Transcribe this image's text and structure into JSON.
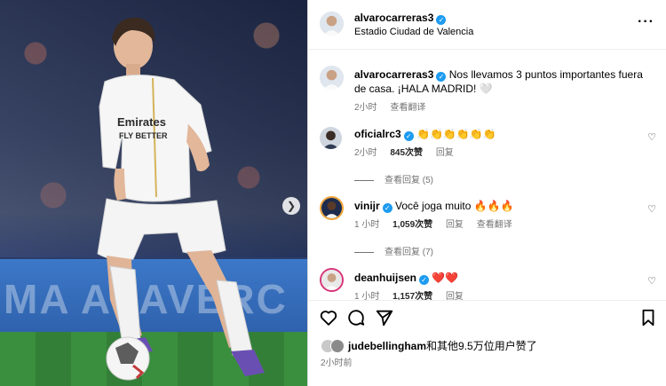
{
  "media": {
    "next_icon": "chevron-right-icon",
    "board_text": "MA ALAVERC"
  },
  "post_header": {
    "username": "alvarocarreras3",
    "location": "Estadio Ciudad de Valencia",
    "more_icon": "more-horizontal-icon",
    "more_label": "···"
  },
  "caption": {
    "username": "alvarocarreras3",
    "text": "Nos llevamos 3 puntos importantes fuera de casa. ¡HALA MADRID! 🤍",
    "time": "2小时",
    "translate": "查看翻译"
  },
  "comments": [
    {
      "username": "oficialrc3",
      "text": "👏👏👏👏👏👏",
      "time": "2小时",
      "likes": "845次赞",
      "reply": "回复",
      "translate": "",
      "view_replies": "查看回复 (5)"
    },
    {
      "username": "vinijr",
      "text": "Você joga muito 🔥🔥🔥",
      "time": "1 小时",
      "likes": "1,059次赞",
      "reply": "回复",
      "translate": "查看翻译",
      "view_replies": "查看回复 (7)"
    },
    {
      "username": "deanhuijsen",
      "text": "❤️❤️",
      "time": "1 小时",
      "likes": "1,157次赞",
      "reply": "回复",
      "translate": "",
      "view_replies": ""
    }
  ],
  "actions": {
    "like_icon": "heart-icon",
    "comment_icon": "comment-icon",
    "share_icon": "share-icon",
    "save_icon": "bookmark-icon"
  },
  "likes": {
    "username": "judebellingham",
    "text": "和其他9.5万位用户赞了"
  },
  "post_time": "2小时前",
  "colors": {
    "verified": "#1d9bf0",
    "muted": "#737373",
    "kit": "#ffffff"
  }
}
